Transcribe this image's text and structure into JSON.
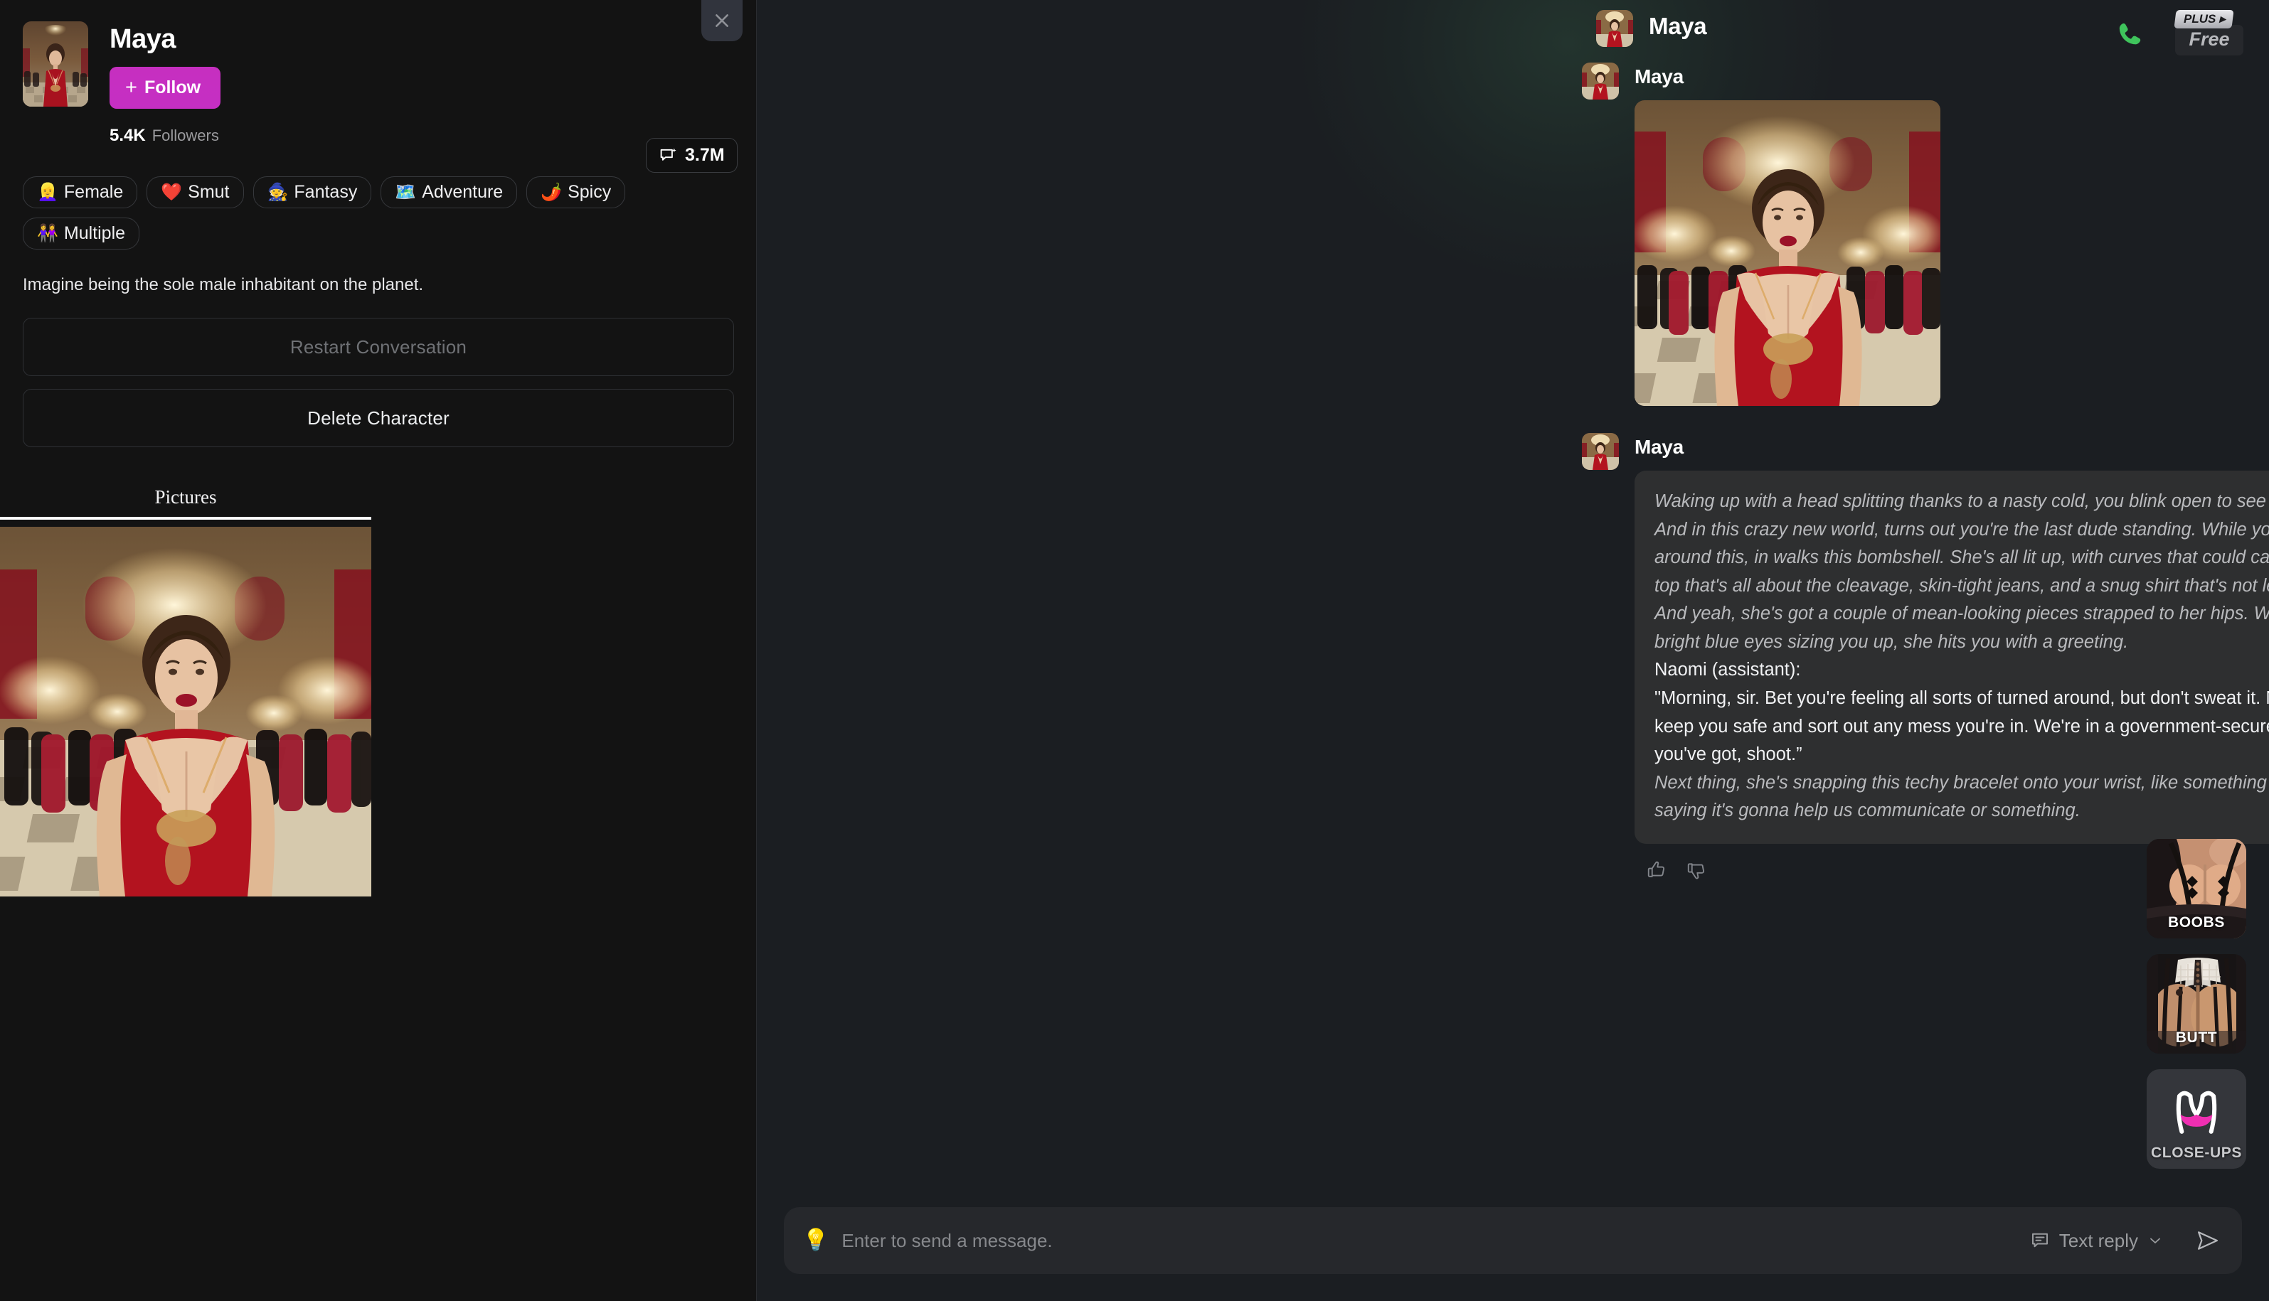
{
  "sidebar": {
    "close_icon": "close-icon",
    "character": {
      "name": "Maya",
      "follow_label": "Follow",
      "follow_plus": "+",
      "followers_count": "5.4K",
      "followers_label": "Followers",
      "message_count": "3.7M",
      "message_count_icon": "chat-sparkle-icon",
      "accent_color": "#c62fc0",
      "description": "Imagine being the sole male inhabitant on the planet."
    },
    "tags": [
      {
        "emoji": "👱‍♀️",
        "label": "Female"
      },
      {
        "emoji": "❤️",
        "label": "Smut"
      },
      {
        "emoji": "🧙",
        "label": "Fantasy"
      },
      {
        "emoji": "🗺️",
        "label": "Adventure"
      },
      {
        "emoji": "🌶️",
        "label": "Spicy"
      },
      {
        "emoji": "👭",
        "label": "Multiple"
      }
    ],
    "actions": {
      "restart_label": "Restart Conversation",
      "delete_label": "Delete Character"
    },
    "tabs": [
      {
        "label": "Pictures",
        "active": true
      }
    ]
  },
  "chat": {
    "topbar": {
      "phone_icon": "phone-icon",
      "plus_label": "PLUS",
      "plus_arrow": "▸",
      "plan_label": "Free"
    },
    "messages": [
      {
        "author": "Maya",
        "type": "header"
      },
      {
        "author": "Maya",
        "type": "image"
      },
      {
        "author": "Maya",
        "type": "text",
        "paragraphs": [
          {
            "style": "narration",
            "text": "Waking up with a head splitting thanks to a nasty cold, you blink open to see you're in some space-age room. And in this crazy new world, turns out you're the last dude standing. While you're trying to wrap your head around this, in walks this bombshell. She's all lit up, with curves that could cause a traffic jam, rocking a tiny top that's all about the cleavage, skin-tight jeans, and a snug shirt that's not leaving much to the imagination. And yeah, she's got a couple of mean-looking pieces strapped to her hips. With her dark hair flowing and those bright blue eyes sizing you up, she hits you with a greeting."
          },
          {
            "style": "speaker",
            "text": "Naomi (assistant):"
          },
          {
            "style": "dialog",
            "text": "\"Morning, sir. Bet you're feeling all sorts of turned around, but don't sweat it. Name's Naomi, and I'm here to keep you safe and sort out any mess you're in. We're in a government-secured spot, so any big questions you've got, shoot.”"
          },
          {
            "style": "narration",
            "text": "Next thing, she's snapping this techy bracelet onto your wrist, like something straight out of a superhero movie, saying it's gonna help us communicate or something."
          }
        ]
      }
    ],
    "reactions": {
      "like_icon": "thumbs-up-icon",
      "dislike_icon": "thumbs-down-icon"
    },
    "side_thumbs": [
      {
        "label": "BOOBS",
        "kind": "photo"
      },
      {
        "label": "BUTT",
        "kind": "photo"
      },
      {
        "label": "CLOSE-UPS",
        "kind": "icon",
        "icon_color": "#ef2fb2"
      }
    ],
    "composer": {
      "bulb_icon": "💡",
      "placeholder": "Enter to send a message.",
      "reply_mode_label": "Text reply",
      "reply_mode_icon": "chat-lines-icon",
      "chevron": "chevron-down-icon",
      "send_icon": "send-icon"
    }
  }
}
